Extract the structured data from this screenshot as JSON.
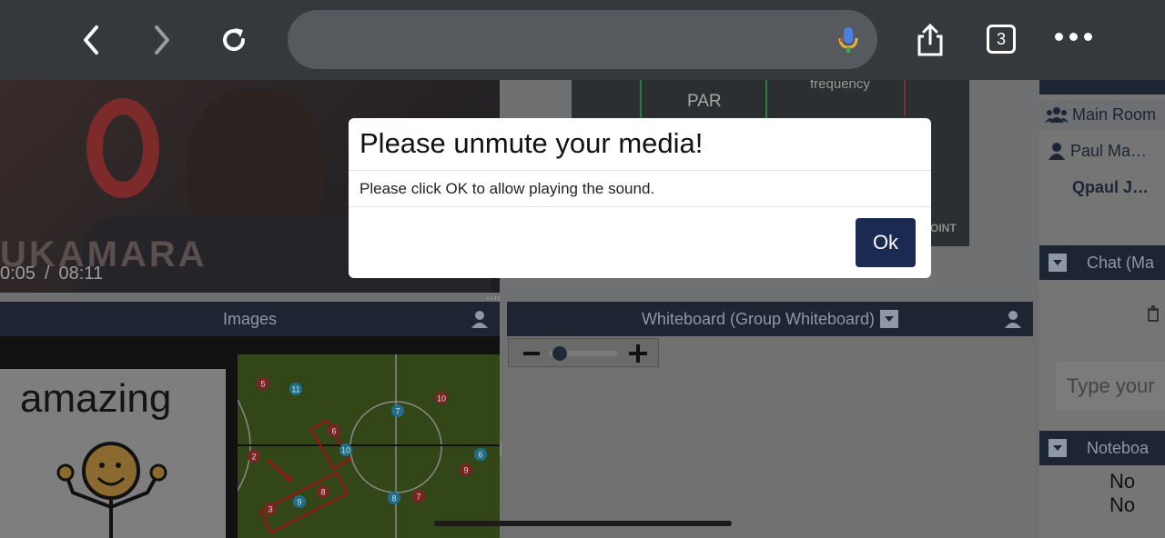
{
  "browser": {
    "back_icon": "chevron-left-icon",
    "forward_icon": "chevron-right-icon",
    "reload_icon": "reload-icon",
    "address": "",
    "mic_icon": "microphone-icon",
    "share_icon": "share-icon",
    "tab_count": "3",
    "more_icon": "more-dots-icon"
  },
  "video": {
    "overlay_name": "UKAMARA",
    "current_time": "0:05",
    "separator": "/",
    "duration": "08:11"
  },
  "scoreboard": {
    "par_label": "PAR",
    "frequency_label": "frequency",
    "brand": "OINT"
  },
  "sidebar": {
    "main_room": "Main Room",
    "user_1": "Paul Ma…",
    "user_2": "Qpaul J…",
    "chat_header": "Chat (Ma",
    "chat_input_placeholder": "Type your",
    "notebook_header": "Noteboa",
    "notebook_empty": "No No"
  },
  "panels": {
    "images_title": "Images",
    "whiteboard_title": "Whiteboard (Group Whiteboard)",
    "amazing_text": "amazing"
  },
  "pitch": {
    "red_players": [
      "5",
      "10",
      "6",
      "2",
      "9",
      "8",
      "3",
      "7"
    ],
    "blue_players": [
      "11",
      "7",
      "10",
      "6",
      "9",
      "8"
    ]
  },
  "modal": {
    "title": "Please unmute your media!",
    "message": "Please click OK to allow playing the sound.",
    "ok_label": "Ok"
  },
  "colors": {
    "chrome_bg": "#36393c",
    "panel_header": "#1d2533",
    "ok_button": "#1b2a52"
  }
}
